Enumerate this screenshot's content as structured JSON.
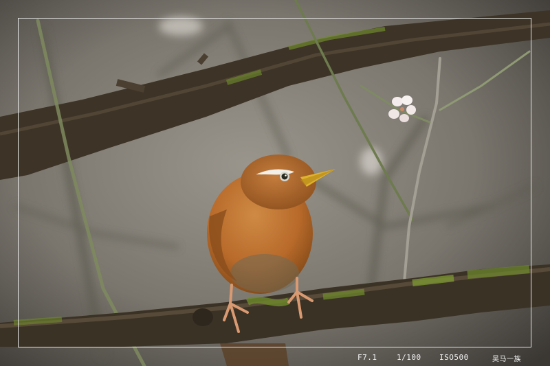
{
  "photo": {
    "subject": "bird-on-branch",
    "colors": {
      "background": "#6e6a62",
      "bird_body": "#b86a2a",
      "branch": "#3d3326",
      "moss": "#6f8a2c",
      "blossom": "#f4ecec",
      "frame_line": "#e9e9e9"
    }
  },
  "exif": {
    "aperture": "F7.1",
    "shutter": "1/100",
    "iso": "ISO500",
    "signature": "吴马一族"
  }
}
